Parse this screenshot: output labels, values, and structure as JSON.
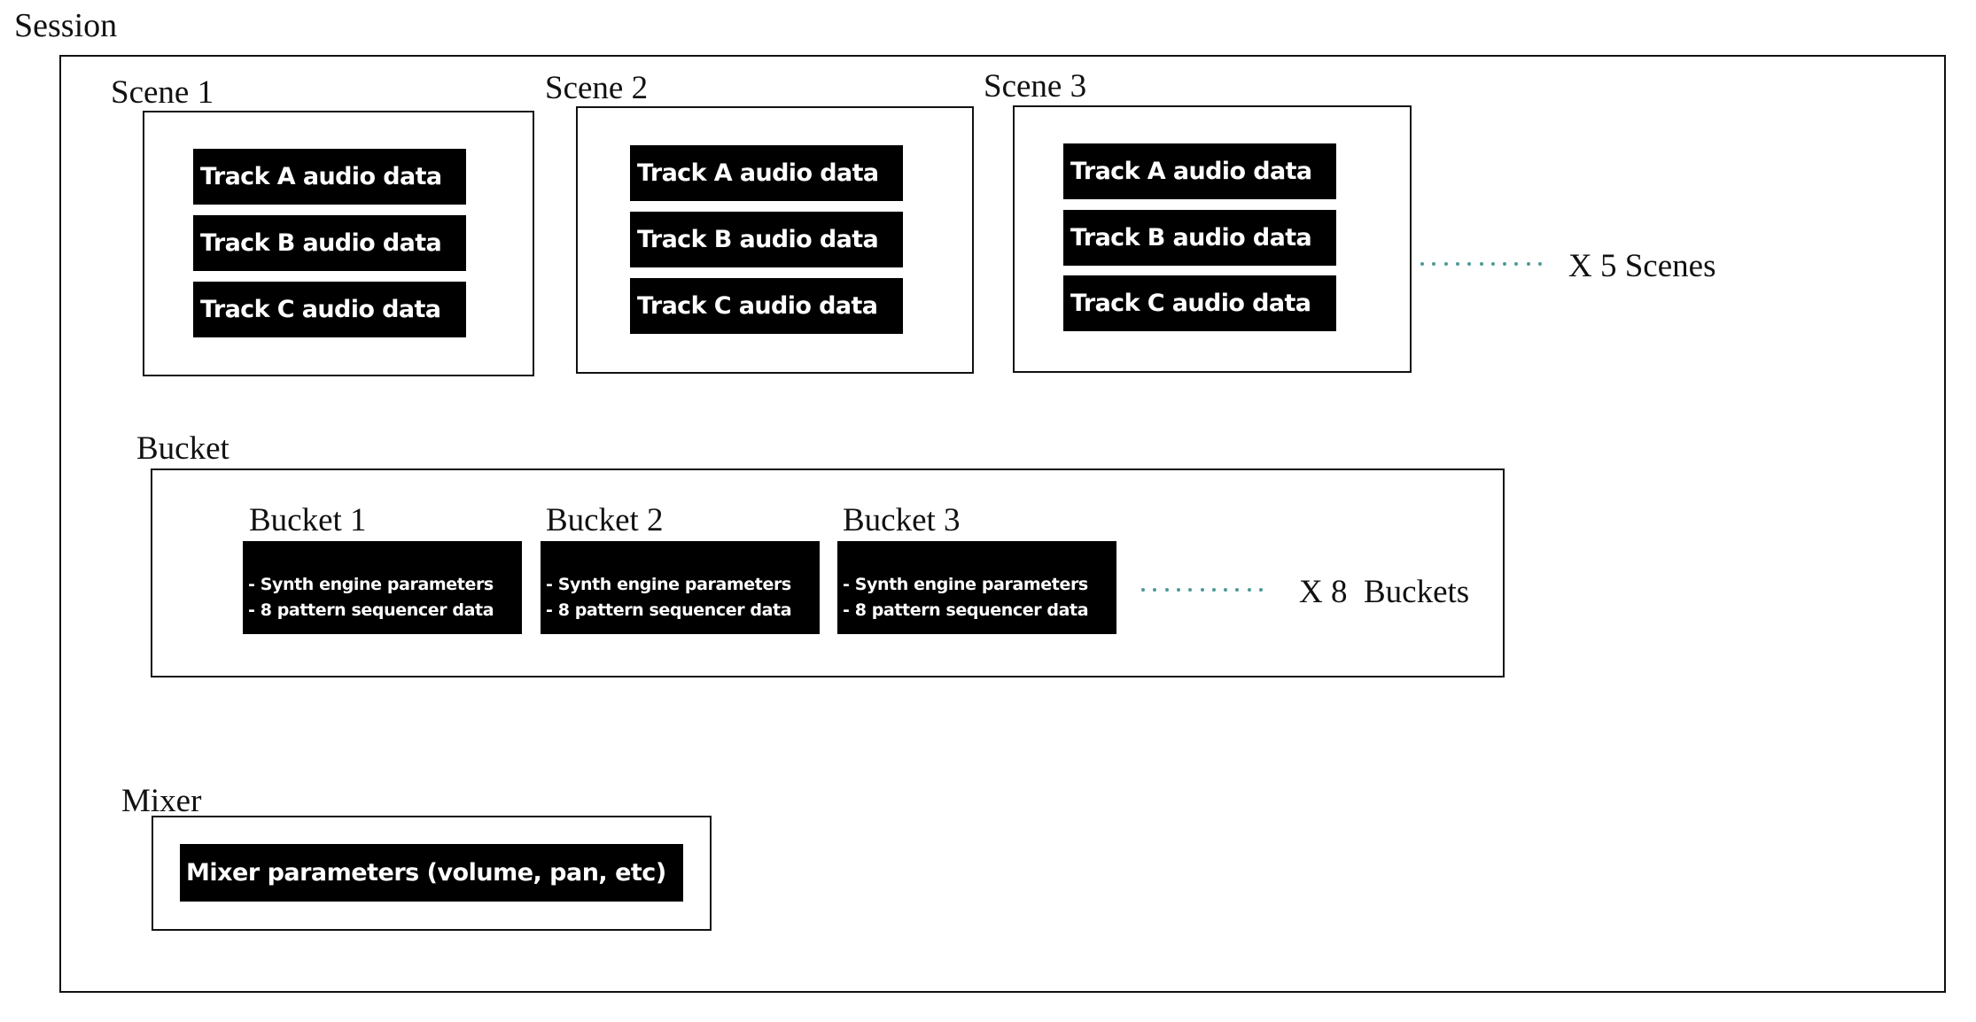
{
  "session": {
    "title": "Session"
  },
  "scenes": {
    "items": [
      {
        "label": "Scene 1",
        "tracks": [
          "Track A audio data",
          "Track B audio data",
          "Track C audio data"
        ]
      },
      {
        "label": "Scene 2",
        "tracks": [
          "Track A audio data",
          "Track B audio data",
          "Track C audio data"
        ]
      },
      {
        "label": "Scene 3",
        "tracks": [
          "Track A audio data",
          "Track B audio data",
          "Track C audio data"
        ]
      }
    ],
    "multiplier_label": "X 5 Scenes",
    "dots_color": "#4d9a98"
  },
  "bucket": {
    "title": "Bucket",
    "items": [
      {
        "label": "Bucket 1",
        "lines": [
          "- Synth engine parameters",
          "- 8 pattern sequencer data"
        ]
      },
      {
        "label": "Bucket 2",
        "lines": [
          "- Synth engine parameters",
          "- 8 pattern sequencer data"
        ]
      },
      {
        "label": "Bucket 3",
        "lines": [
          "- Synth engine parameters",
          "- 8 pattern sequencer data"
        ]
      }
    ],
    "multiplier_label": "X 8  Buckets"
  },
  "mixer": {
    "title": "Mixer",
    "content": "Mixer parameters (volume, pan, etc)"
  }
}
